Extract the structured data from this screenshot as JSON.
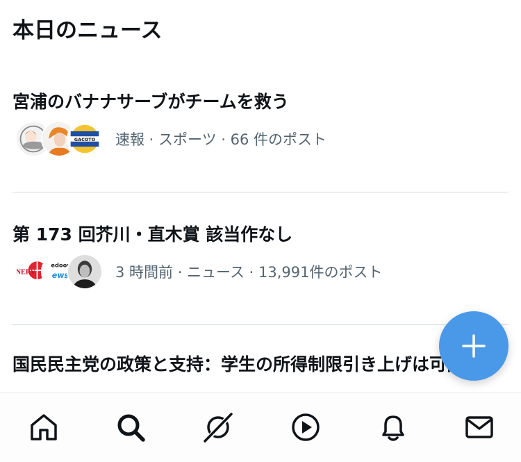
{
  "section_title": "本日のニュース",
  "news": [
    {
      "headline": "宮浦のバナナサーブがチームを救う",
      "meta": "速報 · スポーツ · 66 件のポスト"
    },
    {
      "headline": "第 173 回芥川・直木賞 該当作なし",
      "meta": "3 時間前 · ニュース · 13,991件のポスト"
    },
    {
      "headline": "国民民主党の政策と支持：学生の所得制限引き上げは可能か"
    }
  ],
  "avatar_labels": {
    "nerv": "NERV",
    "news_top": "edoor",
    "news_bottom": "ews",
    "gacoto": "GACOTO"
  },
  "tabs": [
    "home-icon",
    "search-icon",
    "grok-icon",
    "video-icon",
    "notifications-icon",
    "messages-icon"
  ],
  "colors": {
    "accent": "#4a99e9",
    "text": "#0f1419",
    "muted": "#536471",
    "divider": "#cfd9de"
  }
}
